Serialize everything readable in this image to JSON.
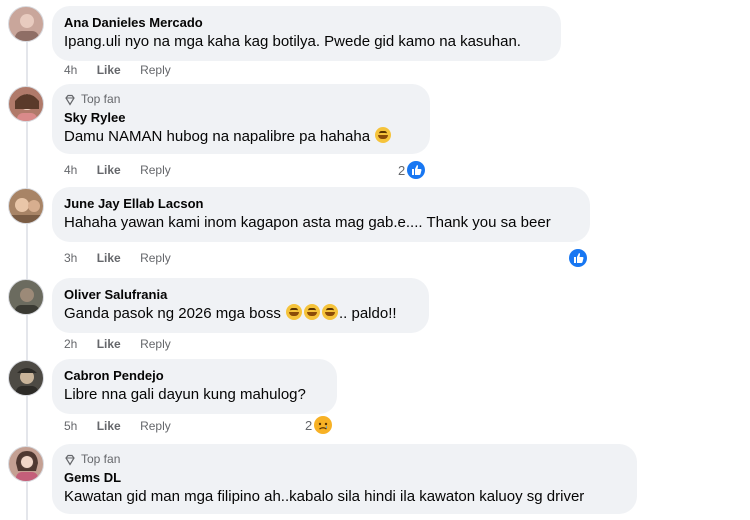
{
  "comments": [
    {
      "author": "Ana Danieles Mercado",
      "text": "Ipang.uli nyo na mga kaha kag botilya. Pwede gid kamo na kasuhan.",
      "time": "4h",
      "like_label": "Like",
      "reply_label": "Reply",
      "avatar_color": "#c9a69b"
    },
    {
      "badge": "Top fan",
      "author": "Sky Rylee",
      "text": "Damu NAMAN hubog na napalibre pa hahaha",
      "time": "4h",
      "like_label": "Like",
      "reply_label": "Reply",
      "reaction_count": "2",
      "reaction_icon": "like-icon",
      "avatar_color": "#b07a6a"
    },
    {
      "author": "June Jay Ellab Lacson",
      "text": "Hahaha yawan kami inom kagapon asta mag gab.e.... Thank you sa beer",
      "time": "3h",
      "like_label": "Like",
      "reply_label": "Reply",
      "reaction_icon": "like-icon",
      "avatar_color": "#a88466"
    },
    {
      "author": "Oliver Salufrania",
      "text": "Ganda pasok ng 2026 mga boss",
      "text_suffix": ".. paldo!!",
      "time": "2h",
      "like_label": "Like",
      "reply_label": "Reply",
      "avatar_color": "#6b6b5f"
    },
    {
      "author": "Cabron Pendejo",
      "text": "Libre nna gali dayun kung mahulog?",
      "time": "5h",
      "like_label": "Like",
      "reply_label": "Reply",
      "reaction_count": "2",
      "reaction_icon": "sad-icon",
      "avatar_color": "#4d4a44"
    },
    {
      "badge": "Top fan",
      "author": "Gems DL",
      "text": "Kawatan gid man mga filipino ah..kabalo sila hindi ila kawaton kaluoy sg driver",
      "avatar_color": "#c4a093"
    }
  ],
  "colors": {
    "bubble": "#f0f2f5",
    "meta_text": "#65676b",
    "like_blue": "#1877f2",
    "sad_yellow": "#f7b125"
  }
}
